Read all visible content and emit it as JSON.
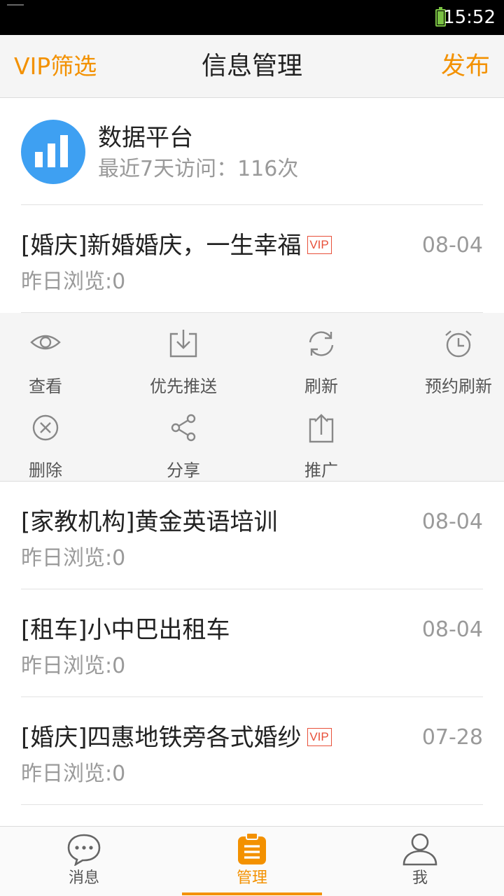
{
  "status": {
    "time": "15:52"
  },
  "header": {
    "left": "VIP筛选",
    "title": "信息管理",
    "right": "发布"
  },
  "data_platform": {
    "name": "数据平台",
    "visits": "最近7天访问：116次"
  },
  "posts": [
    {
      "title": "[婚庆]新婚婚庆，一生幸福",
      "vip": "VIP",
      "date": "08-04",
      "views": "昨日浏览:0"
    },
    {
      "title": "[家教机构]黄金英语培训",
      "vip": "",
      "date": "08-04",
      "views": "昨日浏览:0"
    },
    {
      "title": "[租车]小中巴出租车",
      "vip": "",
      "date": "08-04",
      "views": "昨日浏览:0"
    },
    {
      "title": "[婚庆]四惠地铁旁各式婚纱",
      "vip": "VIP",
      "date": "07-28",
      "views": "昨日浏览:0"
    }
  ],
  "actions": [
    {
      "label": "查看",
      "icon": "eye-icon"
    },
    {
      "label": "优先推送",
      "icon": "download-icon"
    },
    {
      "label": "刷新",
      "icon": "refresh-icon"
    },
    {
      "label": "预约刷新",
      "icon": "alarm-clock-icon"
    },
    {
      "label": "删除",
      "icon": "close-circle-icon"
    },
    {
      "label": "分享",
      "icon": "share-icon"
    },
    {
      "label": "推广",
      "icon": "upload-icon"
    }
  ],
  "tabs": [
    {
      "label": "消息",
      "icon": "chat-bubble-icon"
    },
    {
      "label": "管理",
      "icon": "clipboard-icon",
      "active": true
    },
    {
      "label": "我",
      "icon": "person-icon"
    }
  ],
  "colors": {
    "accent": "#f39100",
    "vip": "#e8503a",
    "platform": "#3ea0f2"
  }
}
